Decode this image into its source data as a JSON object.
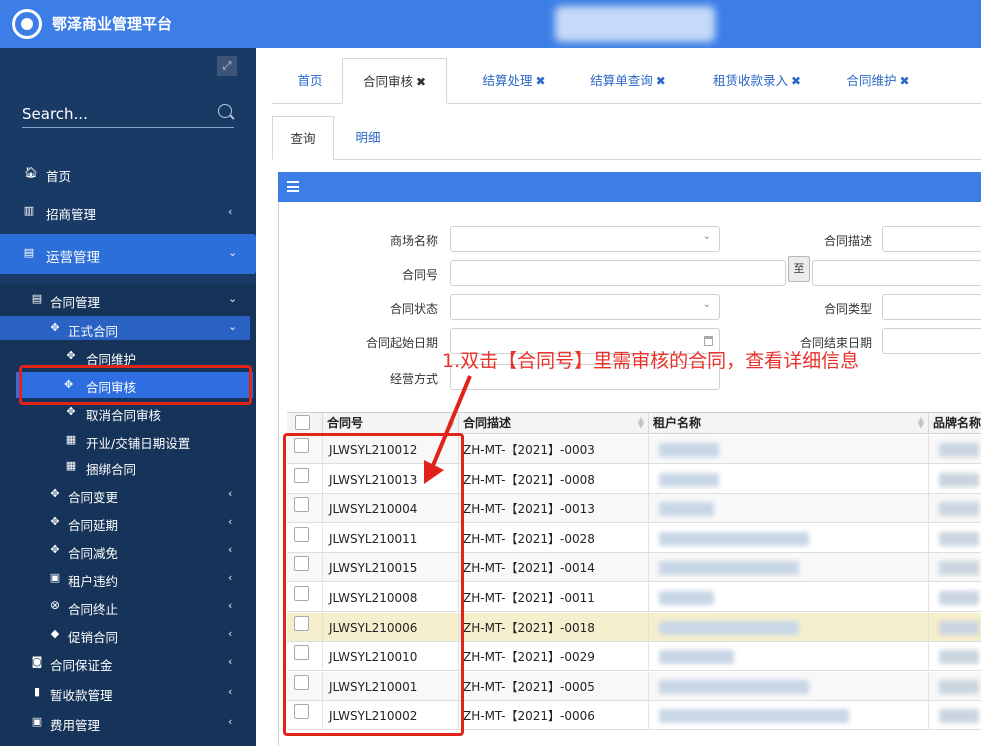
{
  "app": {
    "title": "鄂泽商业管理平台"
  },
  "sidebar": {
    "collapse_icon": "expand-icon",
    "search_placeholder": "Search...",
    "items": [
      {
        "label": "首页",
        "icon": "home-icon"
      },
      {
        "label": "招商管理",
        "icon": "chart-icon"
      },
      {
        "label": "运营管理",
        "icon": "operation-icon"
      },
      {
        "label": "合同管理",
        "icon": "contract-icon"
      },
      {
        "label": "正式合同",
        "icon": "handshake-icon"
      },
      {
        "label": "合同维护",
        "icon": "handshake-icon"
      },
      {
        "label": "合同审核",
        "icon": "handshake-icon"
      },
      {
        "label": "取消合同审核",
        "icon": "handshake-icon"
      },
      {
        "label": "开业/交铺日期设置",
        "icon": "calendar-icon"
      },
      {
        "label": "捆绑合同",
        "icon": "calendar-icon"
      },
      {
        "label": "合同变更",
        "icon": "handshake-icon"
      },
      {
        "label": "合同延期",
        "icon": "handshake-icon"
      },
      {
        "label": "合同减免",
        "icon": "handshake-icon"
      },
      {
        "label": "租户违约",
        "icon": "user-icon"
      },
      {
        "label": "合同终止",
        "icon": "close-circle-icon"
      },
      {
        "label": "促销合同",
        "icon": "tag-icon"
      },
      {
        "label": "合同保证金",
        "icon": "deposit-icon"
      },
      {
        "label": "暂收款管理",
        "icon": "bars-icon"
      },
      {
        "label": "费用管理",
        "icon": "money-icon"
      }
    ]
  },
  "tabs": [
    {
      "label": "首页",
      "closable": false
    },
    {
      "label": "合同审核",
      "closable": true
    },
    {
      "label": "结算处理",
      "closable": true
    },
    {
      "label": "结算单查询",
      "closable": true
    },
    {
      "label": "租赁收款录入",
      "closable": true
    },
    {
      "label": "合同维护",
      "closable": true
    }
  ],
  "subtabs": [
    "查询",
    "明细"
  ],
  "form": {
    "mall_name": "商场名称",
    "contract_desc": "合同描述",
    "contract_no": "合同号",
    "to": "至",
    "contract_status": "合同状态",
    "contract_type": "合同类型",
    "start_date": "合同起始日期",
    "end_date": "合同结束日期",
    "biz_mode": "经营方式"
  },
  "table": {
    "columns": [
      "合同号",
      "合同描述",
      "租户名称",
      "品牌名称"
    ],
    "rows": [
      {
        "no": "JLWSYL210012",
        "desc": "ZH-MT-【2021】-0003"
      },
      {
        "no": "JLWSYL210013",
        "desc": "ZH-MT-【2021】-0008"
      },
      {
        "no": "JLWSYL210004",
        "desc": "ZH-MT-【2021】-0013"
      },
      {
        "no": "JLWSYL210011",
        "desc": "ZH-MT-【2021】-0028"
      },
      {
        "no": "JLWSYL210015",
        "desc": "ZH-MT-【2021】-0014"
      },
      {
        "no": "JLWSYL210008",
        "desc": "ZH-MT-【2021】-0011"
      },
      {
        "no": "JLWSYL210006",
        "desc": "ZH-MT-【2021】-0018"
      },
      {
        "no": "JLWSYL210010",
        "desc": "ZH-MT-【2021】-0029"
      },
      {
        "no": "JLWSYL210001",
        "desc": "ZH-MT-【2021】-0005"
      },
      {
        "no": "JLWSYL210002",
        "desc": "ZH-MT-【2021】-0006"
      }
    ],
    "highlighted_row": 6
  },
  "annotation": {
    "text": "1.双击【合同号】里需审核的合同，查看详细信息"
  },
  "colors": {
    "brand": "#3d7ee6",
    "sidebar": "#1a3a66",
    "annotation": "#e2231a",
    "highlight_row": "#f6efce"
  }
}
